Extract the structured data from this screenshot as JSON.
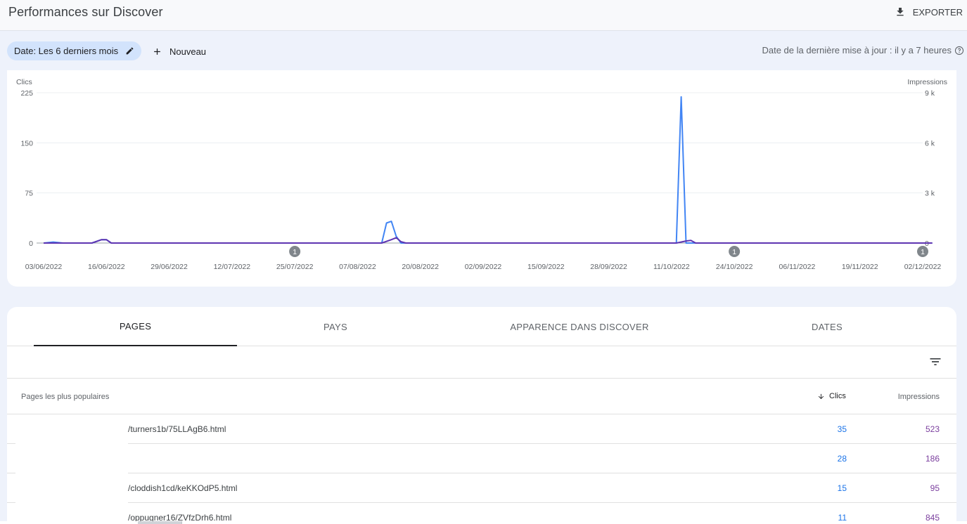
{
  "header": {
    "title": "Performances sur Discover",
    "export_label": "EXPORTER"
  },
  "filters": {
    "date_chip": "Date: Les 6 derniers mois",
    "new_label": "Nouveau",
    "last_update": "Date de la dernière mise à jour : il y a 7 heures"
  },
  "chart_data": {
    "type": "line",
    "left_axis_label": "Clics",
    "right_axis_label": "Impressions",
    "left_ticks": [
      "225",
      "150",
      "75",
      "0"
    ],
    "left_tick_values": [
      225,
      150,
      75,
      0
    ],
    "right_ticks": [
      "9 k",
      "6 k",
      "3 k",
      "0"
    ],
    "x_tick_labels": [
      "03/06/2022",
      "16/06/2022",
      "29/06/2022",
      "12/07/2022",
      "25/07/2022",
      "07/08/2022",
      "20/08/2022",
      "02/09/2022",
      "15/09/2022",
      "28/09/2022",
      "11/10/2022",
      "24/10/2022",
      "06/11/2022",
      "19/11/2022",
      "02/12/2022"
    ],
    "ylim_clics": [
      0,
      225
    ],
    "ylim_impressions": [
      0,
      9000
    ],
    "annotations": [
      {
        "label": "1",
        "date_index": 4
      },
      {
        "label": "1",
        "date_index": 11
      },
      {
        "label": "1",
        "date_index": 14
      }
    ],
    "series": [
      {
        "name": "Clics",
        "color": "#5e35b1",
        "points": [
          [
            0,
            0
          ],
          [
            10,
            0
          ],
          [
            12,
            5
          ],
          [
            13,
            5
          ],
          [
            14,
            0
          ],
          [
            70,
            0
          ],
          [
            72,
            5
          ],
          [
            73,
            8
          ],
          [
            74,
            2
          ],
          [
            75,
            0
          ],
          [
            131,
            0
          ],
          [
            133,
            3
          ],
          [
            134,
            4
          ],
          [
            135,
            0
          ],
          [
            184,
            0
          ]
        ]
      },
      {
        "name": "Impressions",
        "color": "#4285f4",
        "points": [
          [
            0,
            0
          ],
          [
            2,
            60
          ],
          [
            4,
            0
          ],
          [
            10,
            0
          ],
          [
            12,
            200
          ],
          [
            13,
            200
          ],
          [
            14,
            0
          ],
          [
            70,
            0
          ],
          [
            71,
            1200
          ],
          [
            72,
            1300
          ],
          [
            73,
            400
          ],
          [
            74,
            0
          ],
          [
            131,
            0
          ],
          [
            132,
            8750
          ],
          [
            133,
            0
          ],
          [
            184,
            0
          ]
        ]
      }
    ],
    "x_days_total": 182
  },
  "tabs": [
    {
      "label": "PAGES",
      "active": true
    },
    {
      "label": "PAYS",
      "active": false
    },
    {
      "label": "APPARENCE DANS DISCOVER",
      "active": false
    },
    {
      "label": "DATES",
      "active": false
    }
  ],
  "table": {
    "col_pages": "Pages les plus populaires",
    "col_clics": "Clics",
    "col_impressions": "Impressions",
    "rows": [
      {
        "url": "/turners1b/75LLAgB6.html",
        "clics": "35",
        "impressions": "523"
      },
      {
        "url": "",
        "clics": "28",
        "impressions": "186"
      },
      {
        "url": "/cloddish1cd/keKKOdP5.html",
        "clics": "15",
        "impressions": "95"
      },
      {
        "url": "/oppugner16/ZVfzDrh6.html",
        "clics": "11",
        "impressions": "845"
      }
    ]
  },
  "icons": {
    "export": "download-icon",
    "edit": "pencil-icon",
    "add": "plus-icon",
    "help": "help-circle-icon",
    "filter": "filter-lines-icon",
    "sort": "arrow-down-icon"
  }
}
